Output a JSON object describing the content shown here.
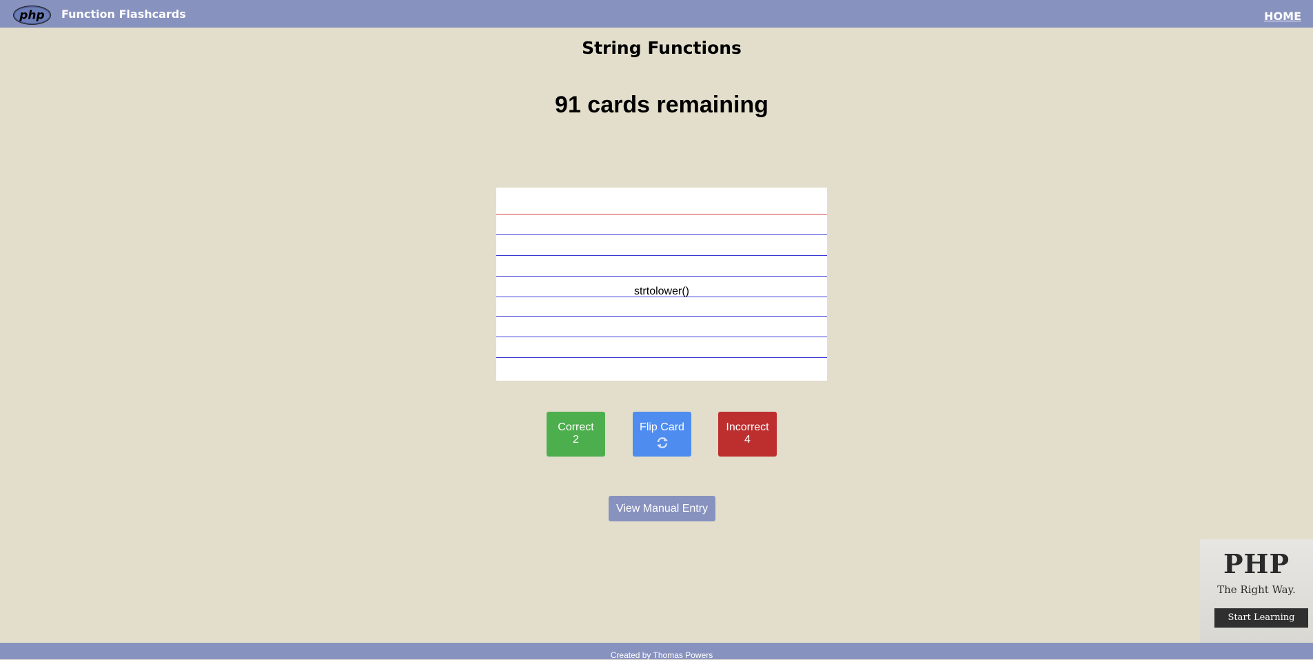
{
  "header": {
    "logo_text": "php",
    "app_title": "Function Flashcards",
    "home_link": "HOME"
  },
  "deck": {
    "title": "String Functions",
    "remaining_text": "91 cards remaining"
  },
  "card": {
    "text": "strtolower()"
  },
  "actions": {
    "correct_label": "Correct",
    "correct_count": "2",
    "flip_label": "Flip Card",
    "flip_icon": "refresh-icon",
    "incorrect_label": "Incorrect",
    "incorrect_count": "4",
    "manual_label": "View Manual Entry"
  },
  "promo": {
    "title": "PHP",
    "tagline": "The Right Way.",
    "button": "Start Learning"
  },
  "footer": {
    "text": "Created by Thomas Powers"
  },
  "colors": {
    "header_bg": "#8892bf",
    "page_bg": "#e2decb",
    "correct": "#4cae4c",
    "flip": "#4f8cef",
    "incorrect": "#bd2f2f"
  }
}
